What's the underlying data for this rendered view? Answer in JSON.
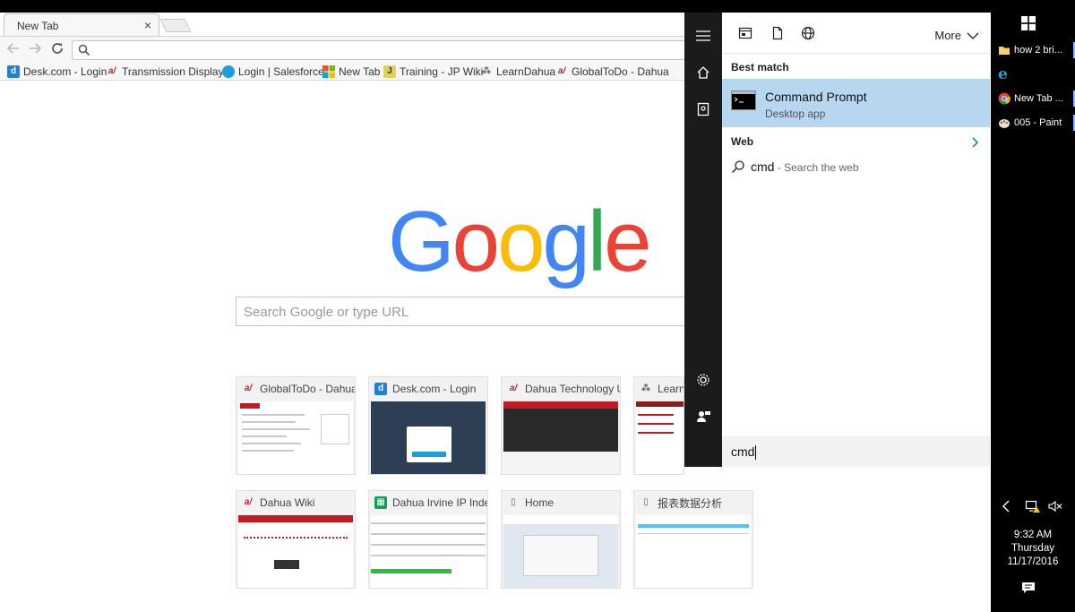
{
  "browser": {
    "tab_title": "New Tab",
    "tab_close": "×",
    "address_value": "",
    "bookmarks": [
      {
        "label": "Desk.com - Login",
        "icon": "desk-icon",
        "color": "#1f7fd8"
      },
      {
        "label": "Transmission Display",
        "icon": "dahua-icon",
        "color": "#c21b21"
      },
      {
        "label": "Login | Salesforce",
        "icon": "salesforce-icon",
        "color": "#1a9ede"
      },
      {
        "label": "New Tab",
        "icon": "windows-tiles-icon",
        "color": "#f25022"
      },
      {
        "label": "Training - JP Wiki",
        "icon": "wiki-icon",
        "color": "#5a7d2a"
      },
      {
        "label": "LearnDahua",
        "icon": "people-icon",
        "color": "#555555"
      },
      {
        "label": "GlobalToDo - Dahua",
        "icon": "dahua-icon",
        "color": "#c21b21"
      }
    ]
  },
  "newtab": {
    "logo_letters": [
      "G",
      "o",
      "o",
      "g",
      "l",
      "e"
    ],
    "search_placeholder": "Search Google or type URL",
    "tiles": [
      {
        "title": "GlobalToDo - Dahua",
        "icon": "dahua-icon"
      },
      {
        "title": "Desk.com - Login",
        "icon": "desk-icon"
      },
      {
        "title": "Dahua Technology U",
        "icon": "dahua-icon"
      },
      {
        "title": "Learn",
        "icon": "people-icon"
      },
      {
        "title": "Dahua Wiki",
        "icon": "dahua-icon"
      },
      {
        "title": "Dahua Irvine IP Index",
        "icon": "sheets-icon"
      },
      {
        "title": "Home",
        "icon": "page-icon"
      },
      {
        "title": "报表数据分析",
        "icon": "page-icon"
      }
    ]
  },
  "start": {
    "more_label": "More",
    "best_match_label": "Best match",
    "best_match": {
      "title": "Command Prompt",
      "subtitle": "Desktop app"
    },
    "web_label": "Web",
    "web_query": "cmd",
    "web_hint": " - Search the web",
    "search_value": "cmd"
  },
  "taskbar": {
    "items": [
      {
        "label": "how 2 bri...",
        "icon": "folder-icon"
      },
      {
        "label": "",
        "icon": "ie-icon"
      },
      {
        "label": "New Tab ...",
        "icon": "chrome-icon"
      },
      {
        "label": "005 - Paint",
        "icon": "paint-icon"
      }
    ],
    "time": "9:32 AM",
    "day": "Thursday",
    "date": "11/17/2016"
  },
  "colors": {
    "highlight": "#b7d6f0",
    "rail": "#1b1b1b",
    "accent": "#0078d7"
  }
}
